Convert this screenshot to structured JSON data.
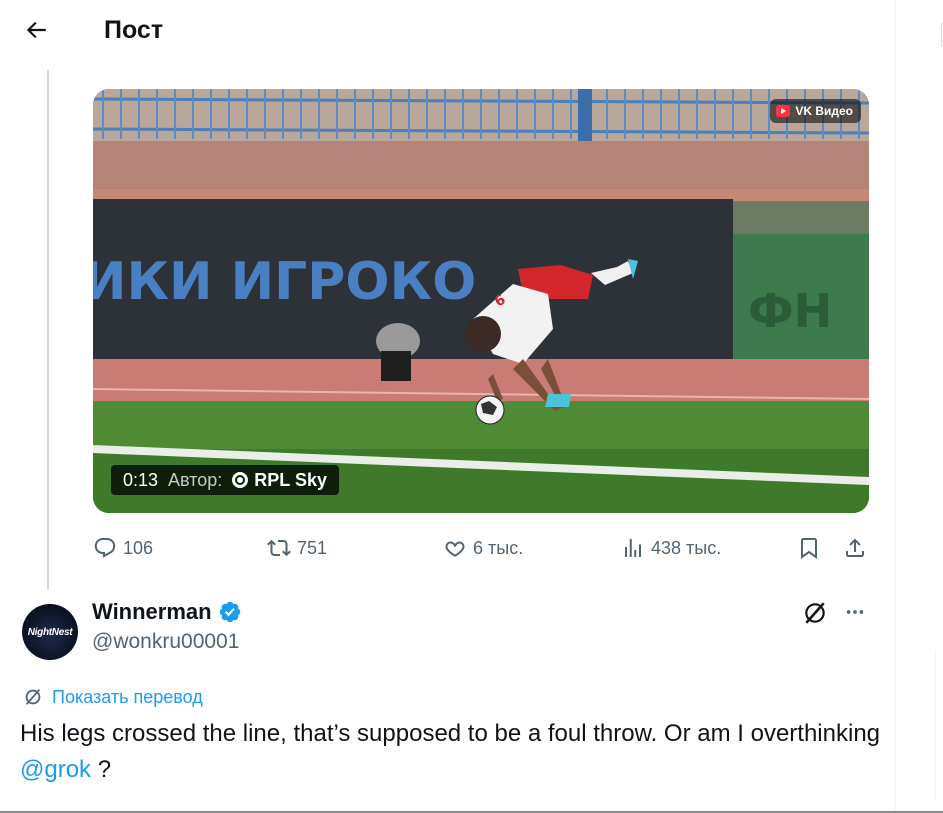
{
  "header": {
    "title": "Пост",
    "back_icon": "arrow-left-icon"
  },
  "video": {
    "source_badge": "VK Видео",
    "time": "0:13",
    "author_label": "Автор:",
    "author_name": "RPL Sky",
    "banner_text": "ИКИ ИГРОКО",
    "banner_right_text": "ФН"
  },
  "actions": {
    "replies": "106",
    "reposts": "751",
    "likes": "6 тыс.",
    "views": "438 тыс."
  },
  "reply": {
    "avatar_text": "NightNest",
    "name": "Winnerman",
    "handle": "@wonkru00001",
    "translate_label": "Показать перевод",
    "text_before": "His legs crossed the line, that’s supposed to be a foul throw. Or am I overthinking ",
    "mention": "@grok",
    "text_after": " ?"
  },
  "colors": {
    "accent": "#1d9bf0",
    "text_primary": "#0f1419",
    "text_secondary": "#536471",
    "verified": "#1d9bf0"
  }
}
